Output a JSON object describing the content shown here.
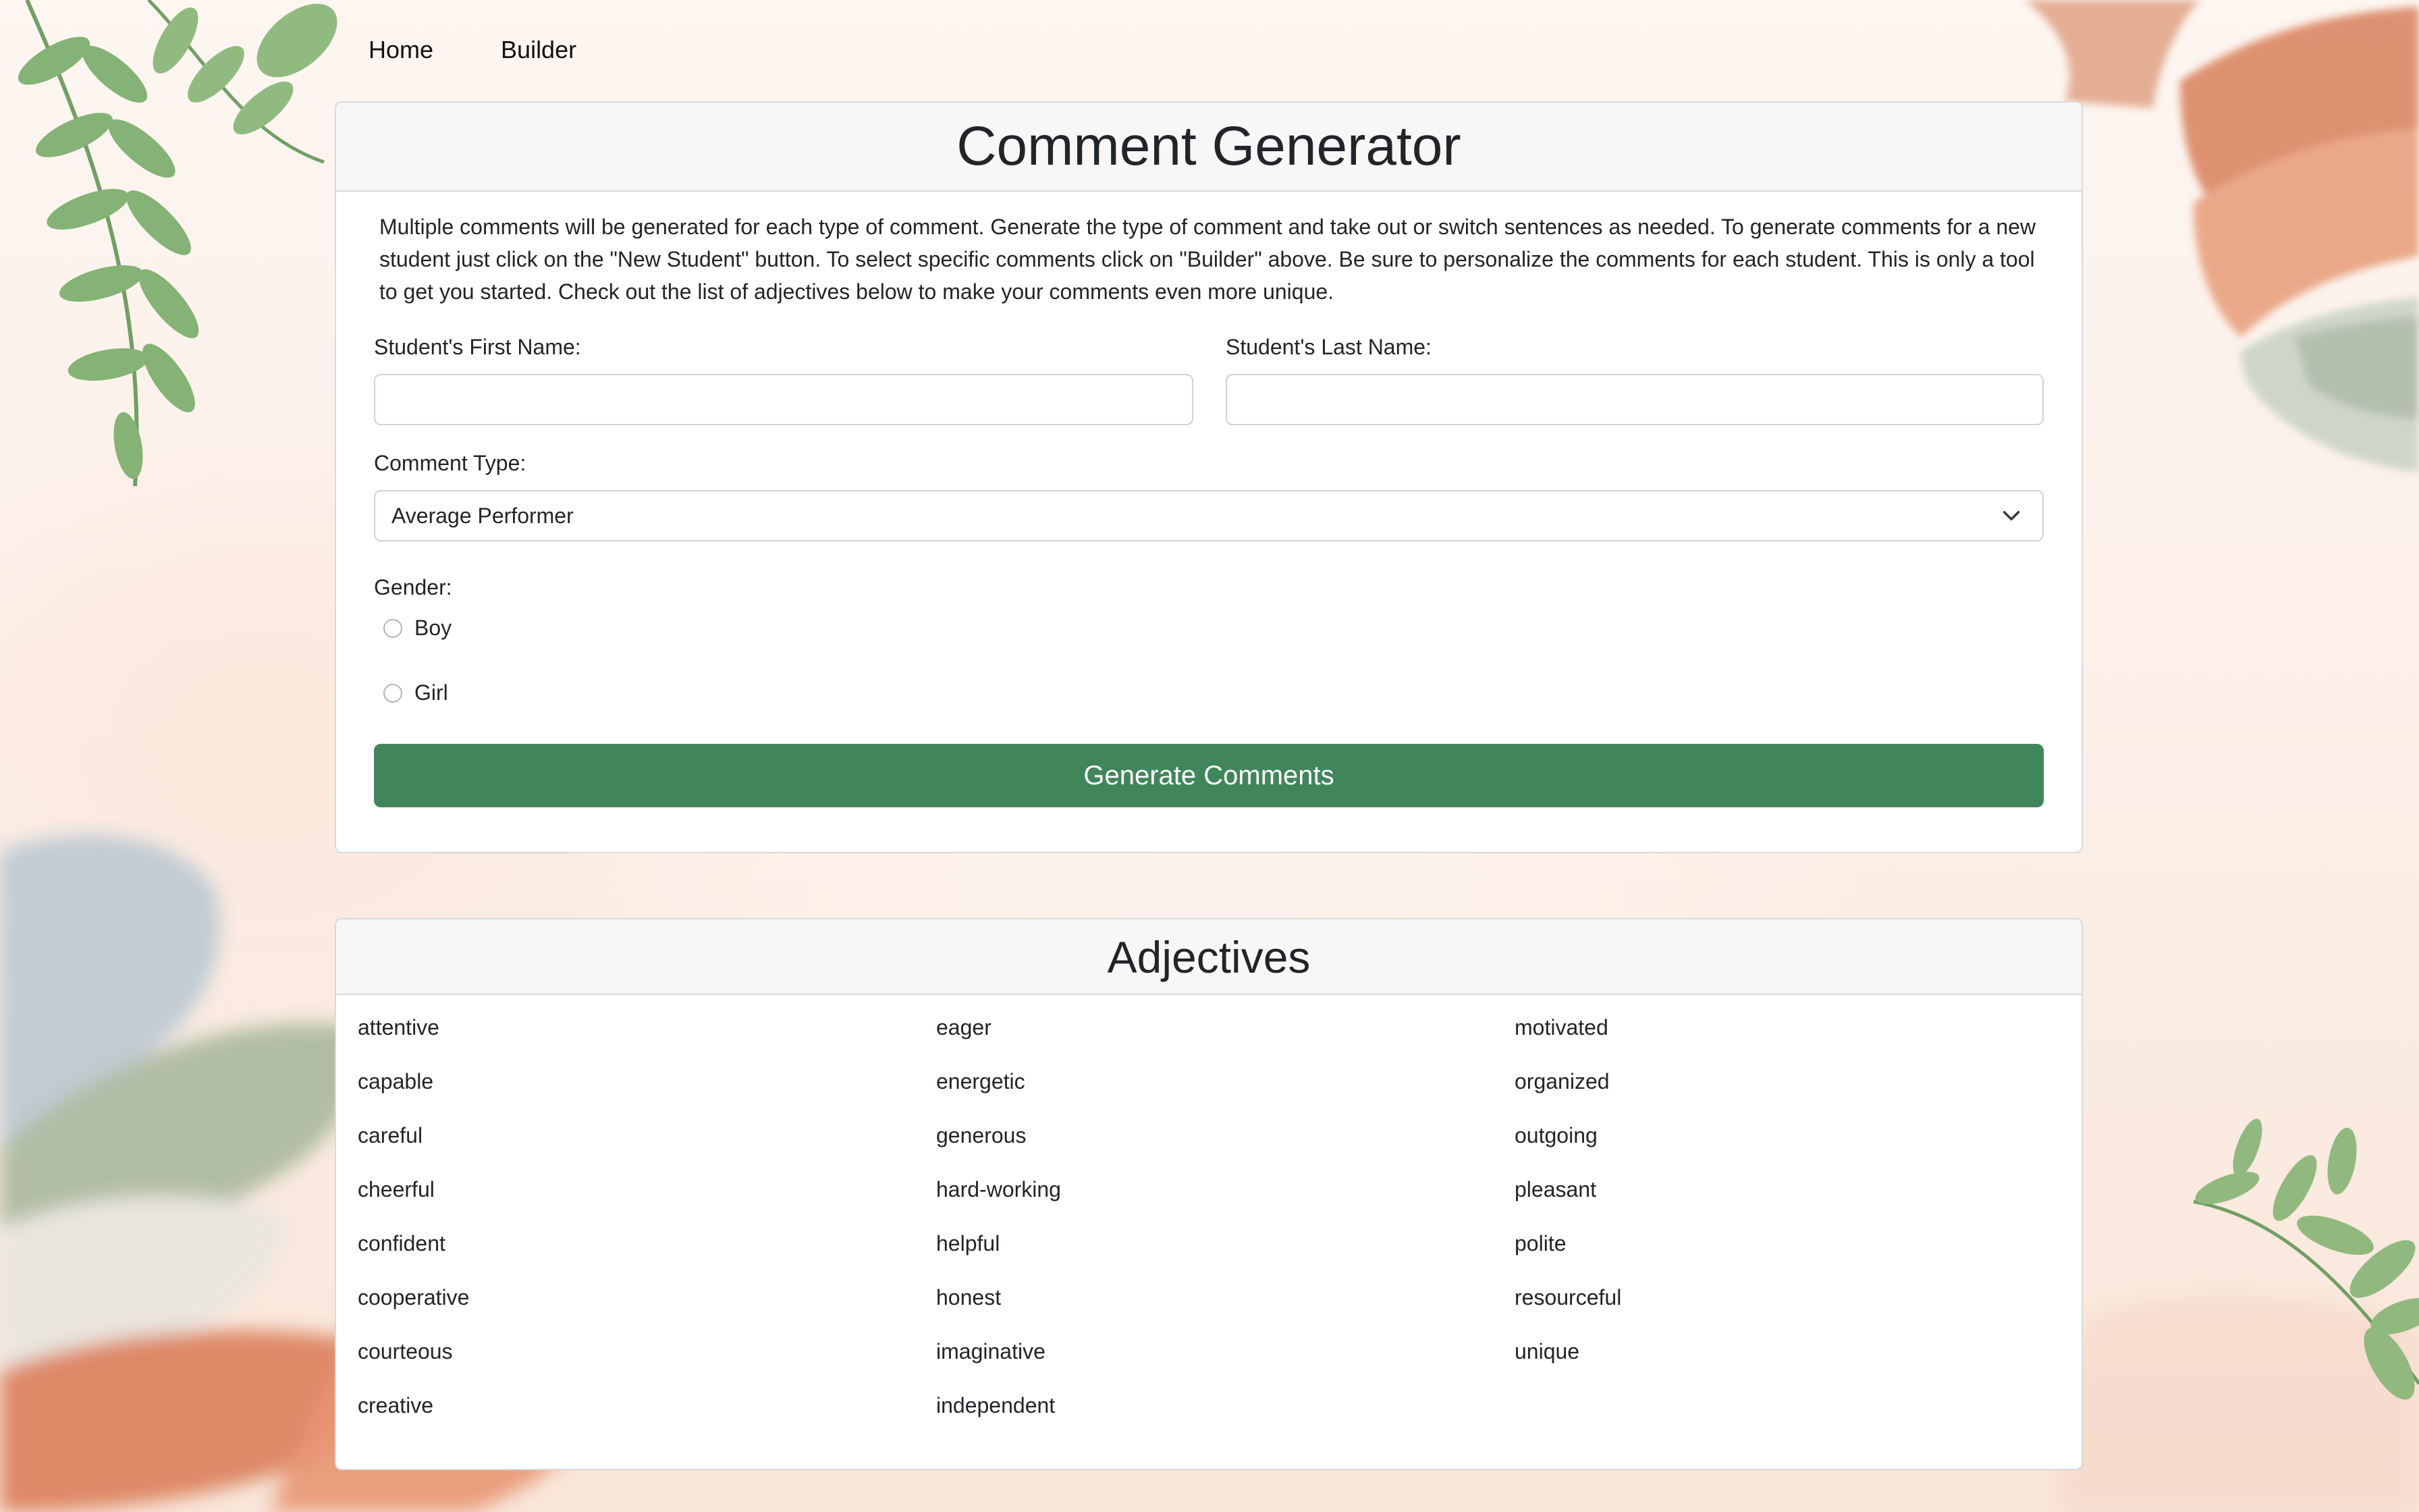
{
  "nav": {
    "items": [
      {
        "label": "Home"
      },
      {
        "label": "Builder"
      }
    ]
  },
  "generator": {
    "title": "Comment Generator",
    "intro": "Multiple comments will be generated for each type of comment. Generate the type of comment and take out or switch sentences as needed. To generate comments for a new student just click on the \"New Student\" button. To select specific comments click on \"Builder\" above. Be sure to personalize the comments for each student. This is only a tool to get you started. Check out the list of adjectives below to make your comments even more unique.",
    "first_name_label": "Student's First Name:",
    "first_name_value": "",
    "last_name_label": "Student's Last Name:",
    "last_name_value": "",
    "comment_type_label": "Comment Type:",
    "comment_type_value": "Average Performer",
    "gender_label": "Gender:",
    "gender_options": [
      {
        "label": "Boy",
        "checked": false
      },
      {
        "label": "Girl",
        "checked": false
      }
    ],
    "generate_button": "Generate Comments",
    "button_color": "#41865b"
  },
  "adjectives": {
    "title": "Adjectives",
    "items": [
      "attentive",
      "capable",
      "careful",
      "cheerful",
      "confident",
      "cooperative",
      "courteous",
      "creative",
      "eager",
      "energetic",
      "generous",
      "hard-working",
      "helpful",
      "honest",
      "imaginative",
      "independent",
      "motivated",
      "organized",
      "outgoing",
      "pleasant",
      "polite",
      "resourceful",
      "unique"
    ]
  },
  "icons": {
    "select_chevron": "chevron-down-icon",
    "radio": "radio-circle"
  }
}
